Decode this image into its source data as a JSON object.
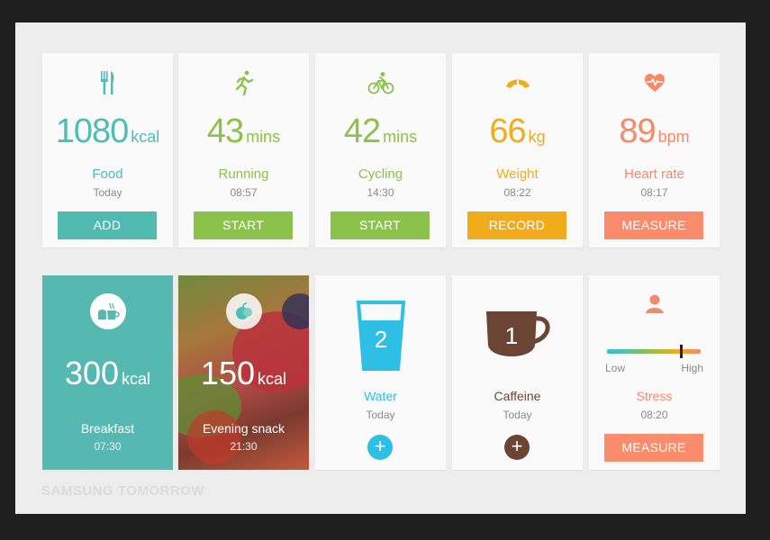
{
  "cards_top": [
    {
      "value": "1080",
      "unit": "kcal",
      "label": "Food",
      "sub": "Today",
      "button": "ADD",
      "icon": "fork-knife-icon",
      "color": "#4dbdb6"
    },
    {
      "value": "43",
      "unit": "mins",
      "label": "Running",
      "sub": "08:57",
      "button": "START",
      "icon": "runner-icon",
      "color": "#8bc34a"
    },
    {
      "value": "42",
      "unit": "mins",
      "label": "Cycling",
      "sub": "14:30",
      "button": "START",
      "icon": "cyclist-icon",
      "color": "#8bc34a"
    },
    {
      "value": "66",
      "unit": "kg",
      "label": "Weight",
      "sub": "08:22",
      "button": "RECORD",
      "icon": "scale-icon",
      "color": "#f0ac1a"
    },
    {
      "value": "89",
      "unit": "bpm",
      "label": "Heart rate",
      "sub": "08:17",
      "button": "MEASURE",
      "icon": "heart-pulse-icon",
      "color": "#f58a69"
    }
  ],
  "breakfast": {
    "value": "300",
    "unit": "kcal",
    "label": "Breakfast",
    "time": "07:30",
    "icon": "bread-cup-icon"
  },
  "snack": {
    "value": "150",
    "unit": "kcal",
    "label": "Evening snack",
    "time": "21:30",
    "icon": "fruit-icon"
  },
  "water": {
    "count": "2",
    "label": "Water",
    "sub": "Today",
    "icon": "glass-icon",
    "color": "#2ebfe4"
  },
  "caffeine": {
    "count": "1",
    "label": "Caffeine",
    "sub": "Today",
    "icon": "cup-icon",
    "color": "#6b4433"
  },
  "stress": {
    "low": "Low",
    "high": "High",
    "label": "Stress",
    "sub": "08:20",
    "button": "MEASURE",
    "icon": "person-icon",
    "level": 0.78
  },
  "watermark": "SAMSUNG TOMORROW"
}
